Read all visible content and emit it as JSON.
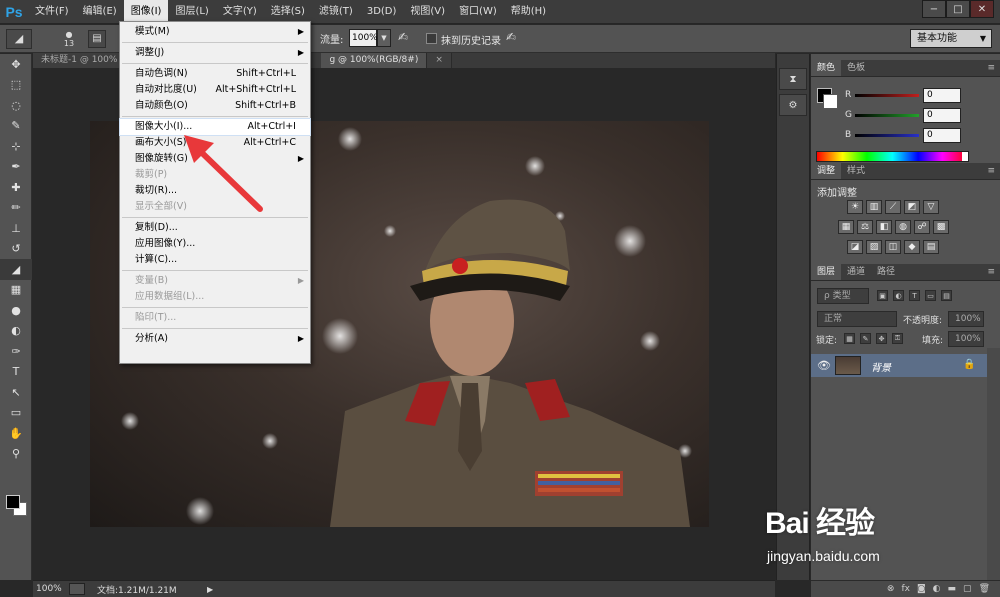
{
  "app": {
    "logo": "Ps"
  },
  "menubar": {
    "items": [
      "文件(F)",
      "编辑(E)",
      "图像(I)",
      "图层(L)",
      "文字(Y)",
      "选择(S)",
      "滤镜(T)",
      "3D(D)",
      "视图(V)",
      "窗口(W)",
      "帮助(H)"
    ],
    "active_index": 2
  },
  "window_controls": {
    "minimize": "−",
    "restore": "□",
    "close": "✕"
  },
  "options_bar": {
    "brush_size": "13",
    "flow_label": "流量:",
    "flow_value": "100%",
    "erase_history_label": "抹到历史记录",
    "erase_history_checked": false,
    "workspace": "基本功能"
  },
  "doc_tabs": [
    {
      "label": "未标题-1 @ 100%",
      "active": false
    },
    {
      "label": "g @ 100%(RGB/8#)",
      "active": true
    },
    {
      "label": "×",
      "active": false
    }
  ],
  "status_bar": {
    "zoom": "100%",
    "doc_size": "文档:1.21M/1.21M",
    "arrow": "▶"
  },
  "image_menu": {
    "items": [
      {
        "label": "模式(M)",
        "shortcut": "",
        "submenu": true,
        "disabled": false
      },
      {
        "sep": true
      },
      {
        "label": "调整(J)",
        "shortcut": "",
        "submenu": true,
        "disabled": false
      },
      {
        "sep": true
      },
      {
        "label": "自动色调(N)",
        "shortcut": "Shift+Ctrl+L",
        "submenu": false,
        "disabled": false
      },
      {
        "label": "自动对比度(U)",
        "shortcut": "Alt+Shift+Ctrl+L",
        "submenu": false,
        "disabled": false
      },
      {
        "label": "自动颜色(O)",
        "shortcut": "Shift+Ctrl+B",
        "submenu": false,
        "disabled": false
      },
      {
        "sep": true
      },
      {
        "label": "图像大小(I)...",
        "shortcut": "Alt+Ctrl+I",
        "submenu": false,
        "disabled": false,
        "highlight": true
      },
      {
        "label": "画布大小(S)...",
        "shortcut": "Alt+Ctrl+C",
        "submenu": false,
        "disabled": false
      },
      {
        "label": "图像旋转(G)",
        "shortcut": "",
        "submenu": true,
        "disabled": false
      },
      {
        "label": "裁剪(P)",
        "shortcut": "",
        "submenu": false,
        "disabled": true
      },
      {
        "label": "裁切(R)...",
        "shortcut": "",
        "submenu": false,
        "disabled": false
      },
      {
        "label": "显示全部(V)",
        "shortcut": "",
        "submenu": false,
        "disabled": true
      },
      {
        "sep": true
      },
      {
        "label": "复制(D)...",
        "shortcut": "",
        "submenu": false,
        "disabled": false
      },
      {
        "label": "应用图像(Y)...",
        "shortcut": "",
        "submenu": false,
        "disabled": false
      },
      {
        "label": "计算(C)...",
        "shortcut": "",
        "submenu": false,
        "disabled": false
      },
      {
        "sep": true
      },
      {
        "label": "变量(B)",
        "shortcut": "",
        "submenu": true,
        "disabled": true
      },
      {
        "label": "应用数据组(L)...",
        "shortcut": "",
        "submenu": false,
        "disabled": true
      },
      {
        "sep": true
      },
      {
        "label": "陷印(T)...",
        "shortcut": "",
        "submenu": false,
        "disabled": true
      },
      {
        "sep": true
      },
      {
        "label": "分析(A)",
        "shortcut": "",
        "submenu": true,
        "disabled": false
      }
    ]
  },
  "tools": [
    "move-tool",
    "marquee-tool",
    "lasso-tool",
    "quick-select-tool",
    "crop-tool",
    "eyedropper-tool",
    "healing-tool",
    "brush-tool",
    "stamp-tool",
    "history-brush-tool",
    "eraser-tool",
    "gradient-tool",
    "blur-tool",
    "dodge-tool",
    "pen-tool",
    "type-tool",
    "path-select-tool",
    "shape-tool",
    "hand-tool",
    "zoom-tool"
  ],
  "tool_glyphs": [
    "✥",
    "⬚",
    "◌",
    "✎",
    "⊹",
    "✒",
    "✚",
    "✏",
    "⊥",
    "↺",
    "◢",
    "▦",
    "●",
    "◐",
    "✑",
    "T",
    "↖",
    "▭",
    "✋",
    "⚲"
  ],
  "selected_tool": "eraser-tool",
  "color_panel": {
    "tabs": [
      "颜色",
      "色板"
    ],
    "channels": [
      {
        "name": "R",
        "value": "0",
        "color": "#c0201e"
      },
      {
        "name": "G",
        "value": "0",
        "color": "#22a02a"
      },
      {
        "name": "B",
        "value": "0",
        "color": "#2830c8"
      }
    ],
    "foreground": "#000000",
    "background": "#ffffff"
  },
  "adjustments_panel": {
    "tabs": [
      "调整",
      "样式"
    ],
    "title": "添加调整"
  },
  "layers_panel": {
    "tabs": [
      "图层",
      "通道",
      "路径"
    ],
    "kind_filter": "ρ 类型",
    "blend_mode": "正常",
    "opacity_label": "不透明度:",
    "opacity_value": "100%",
    "lock_label": "锁定:",
    "fill_label": "填充:",
    "fill_value": "100%",
    "layer": {
      "name": "背景",
      "visible": true,
      "locked": true
    }
  },
  "watermark": {
    "brand": "Bai 经验",
    "url": "jingyan.baidu.com"
  }
}
